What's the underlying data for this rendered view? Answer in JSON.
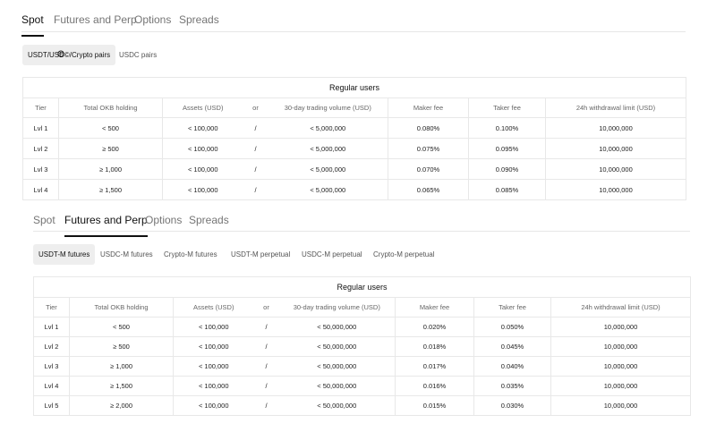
{
  "spot_section": {
    "tabs": [
      {
        "label": "Spot",
        "active": true
      },
      {
        "label": "Futures and Perp",
        "active": false
      },
      {
        "label": "Options",
        "active": false
      },
      {
        "label": "Spreads",
        "active": false
      }
    ],
    "chips": [
      {
        "label": "USDT/USD©/Crypto pairs",
        "active": true
      },
      {
        "label": "USDC pairs",
        "active": false
      }
    ],
    "table": {
      "group_header": "Regular users",
      "columns": [
        "Tier",
        "Total OKB holding",
        "Assets (USD)",
        "or",
        "30-day trading volume (USD)",
        "Maker fee",
        "Taker fee",
        "24h withdrawal limit (USD)"
      ],
      "rows": [
        [
          "Lvl 1",
          "< 500",
          "< 100,000",
          "/",
          "< 5,000,000",
          "0.080%",
          "0.100%",
          "10,000,000"
        ],
        [
          "Lvl 2",
          "≥ 500",
          "< 100,000",
          "/",
          "< 5,000,000",
          "0.075%",
          "0.095%",
          "10,000,000"
        ],
        [
          "Lvl 3",
          "≥ 1,000",
          "< 100,000",
          "/",
          "< 5,000,000",
          "0.070%",
          "0.090%",
          "10,000,000"
        ],
        [
          "Lvl 4",
          "≥ 1,500",
          "< 100,000",
          "/",
          "< 5,000,000",
          "0.065%",
          "0.085%",
          "10,000,000"
        ]
      ]
    }
  },
  "futures_section": {
    "tabs": [
      {
        "label": "Spot",
        "active": false
      },
      {
        "label": "Futures and Perp",
        "active": true
      },
      {
        "label": "Options",
        "active": false
      },
      {
        "label": "Spreads",
        "active": false
      }
    ],
    "chips": [
      {
        "label": "USDT-M futures",
        "active": true
      },
      {
        "label": "USDC-M futures",
        "active": false
      },
      {
        "label": "Crypto-M futures",
        "active": false
      },
      {
        "label": "USDT-M perpetual",
        "active": false
      },
      {
        "label": "USDC-M perpetual",
        "active": false
      },
      {
        "label": "Crypto-M perpetual",
        "active": false
      }
    ],
    "table": {
      "group_header": "Regular users",
      "columns": [
        "Tier",
        "Total OKB holding",
        "Assets (USD)",
        "or",
        "30-day trading volume (USD)",
        "Maker fee",
        "Taker fee",
        "24h withdrawal limit (USD)"
      ],
      "rows": [
        [
          "Lvl 1",
          "< 500",
          "< 100,000",
          "/",
          "< 50,000,000",
          "0.020%",
          "0.050%",
          "10,000,000"
        ],
        [
          "Lvl 2",
          "≥ 500",
          "< 100,000",
          "/",
          "< 50,000,000",
          "0.018%",
          "0.045%",
          "10,000,000"
        ],
        [
          "Lvl 3",
          "≥ 1,000",
          "< 100,000",
          "/",
          "< 50,000,000",
          "0.017%",
          "0.040%",
          "10,000,000"
        ],
        [
          "Lvl 4",
          "≥ 1,500",
          "< 100,000",
          "/",
          "< 50,000,000",
          "0.016%",
          "0.035%",
          "10,000,000"
        ],
        [
          "Lvl 5",
          "≥ 2,000",
          "< 100,000",
          "/",
          "< 50,000,000",
          "0.015%",
          "0.030%",
          "10,000,000"
        ]
      ]
    }
  }
}
